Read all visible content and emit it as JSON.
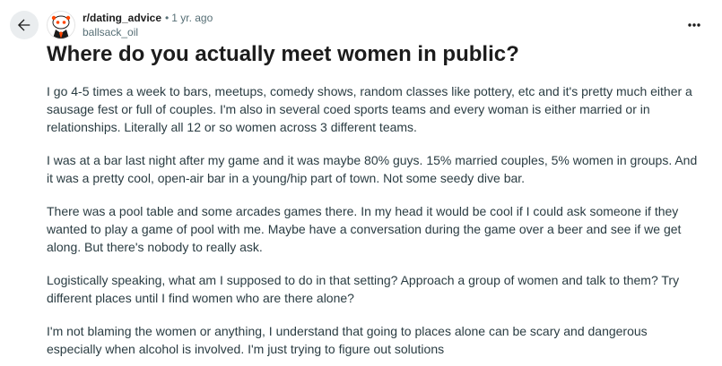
{
  "post": {
    "subreddit": "r/dating_advice",
    "separator": "•",
    "age": "1 yr. ago",
    "author": "ballsack_oil",
    "title": "Where do you actually meet women in public?",
    "paragraphs": [
      "I go 4-5 times a week to bars, meetups, comedy shows, random classes like pottery, etc and it's pretty much either a sausage fest or full of couples. I'm also in several coed sports teams and every woman is either married or in relationships. Literally all 12 or so women across 3 different teams.",
      "I was at a bar last night after my game and it was maybe 80% guys. 15% married couples, 5% women in groups. And it was a pretty cool, open-air bar in a young/hip part of town. Not some seedy dive bar.",
      "There was a pool table and some arcades games there. In my head it would be cool if I could ask someone if they wanted to play a game of pool with me. Maybe have a conversation during the game over a beer and see if we get along. But there's nobody to really ask.",
      "Logistically speaking, what am I supposed to do in that setting? Approach a group of women and talk to them? Try different places until I find women who are there alone?",
      "I'm not blaming the women or anything, I understand that going to places alone can be scary and dangerous especially when alcohol is involved. I'm just trying to figure out solutions"
    ]
  },
  "controls": {
    "back_icon": "arrow-left-icon",
    "more_icon": "more-horizontal-icon",
    "more_glyph": "•••"
  },
  "colors": {
    "accent": "#ff4500",
    "back_bg": "#eaedef",
    "meta_text": "#576f76",
    "body_text": "#2a3c42"
  }
}
